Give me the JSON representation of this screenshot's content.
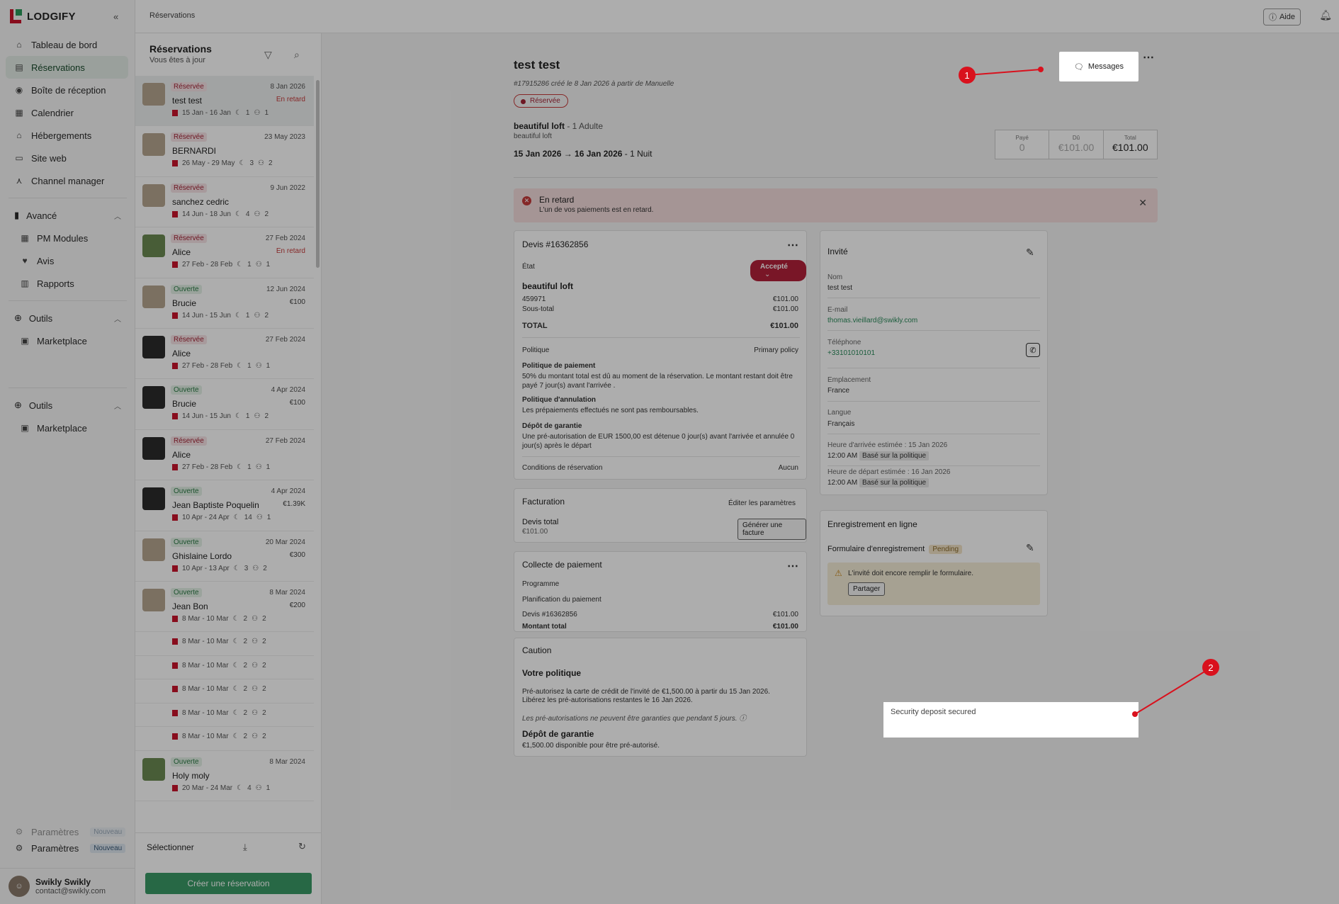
{
  "app": {
    "brand": "LODGIFY",
    "collapse_icon": "double-chevron-left-icon"
  },
  "nav": {
    "items": [
      {
        "label": "Tableau de bord",
        "icon": "home-icon"
      },
      {
        "label": "Réservations",
        "icon": "book-icon",
        "active": true
      },
      {
        "label": "Boîte de réception",
        "icon": "chat-icon"
      },
      {
        "label": "Calendrier",
        "icon": "calendar-icon"
      },
      {
        "label": "Hébergements",
        "icon": "house-icon"
      },
      {
        "label": "Site web",
        "icon": "browser-icon"
      },
      {
        "label": "Channel manager",
        "icon": "network-icon"
      }
    ],
    "advanced": {
      "label": "Avancé",
      "items": [
        "PM Modules",
        "Avis",
        "Rapports"
      ]
    },
    "tools1": {
      "label": "Outils",
      "items": [
        "Marketplace"
      ]
    },
    "tools2": {
      "label": "Outils",
      "items": [
        "Marketplace"
      ]
    },
    "settings_ghost": "Paramètres",
    "settings": "Paramètres",
    "new_badge": "Nouveau"
  },
  "user": {
    "name": "Swikly Swikly",
    "email": "contact@swikly.com"
  },
  "topbar": {
    "breadcrumb": "Réservations",
    "help": "Aide"
  },
  "list": {
    "title": "Réservations",
    "subtitle": "Vous êtes à jour",
    "rows": [
      {
        "status": "Réservée",
        "type": "res",
        "date": "8 Jan 2026",
        "name": "test test",
        "note": "En retard",
        "range": "15 Jan - 16 Jan",
        "nights": "1",
        "guests": "1",
        "thumb": "photo"
      },
      {
        "status": "Réservée",
        "type": "res",
        "date": "23 May 2023",
        "name": "BERNARDI",
        "note": "",
        "range": "26 May - 29 May",
        "nights": "3",
        "guests": "2",
        "thumb": "photo"
      },
      {
        "status": "Réservée",
        "type": "res",
        "date": "9 Jun 2022",
        "name": "sanchez cedric",
        "note": "",
        "range": "14 Jun - 18 Jun",
        "nights": "4",
        "guests": "2",
        "thumb": "photo"
      },
      {
        "status": "Réservée",
        "type": "res",
        "date": "27 Feb 2024",
        "name": "Alice",
        "note": "En retard",
        "range": "27 Feb - 28 Feb",
        "nights": "1",
        "guests": "1",
        "thumb": "green"
      },
      {
        "status": "Ouverte",
        "type": "open",
        "date": "12 Jun 2024",
        "name": "Brucie",
        "note": "€100",
        "range": "14 Jun - 15 Jun",
        "nights": "1",
        "guests": "2",
        "thumb": "photo"
      },
      {
        "status": "Réservée",
        "type": "res",
        "date": "27 Feb 2024",
        "name": "Alice",
        "note": "",
        "range": "27 Feb - 28 Feb",
        "nights": "1",
        "guests": "1",
        "thumb": "dark"
      },
      {
        "status": "Ouverte",
        "type": "open",
        "date": "4 Apr 2024",
        "name": "Brucie",
        "note": "€100",
        "range": "14 Jun - 15 Jun",
        "nights": "1",
        "guests": "2",
        "thumb": "dark"
      },
      {
        "status": "Réservée",
        "type": "res",
        "date": "27 Feb 2024",
        "name": "Alice",
        "note": "",
        "range": "27 Feb - 28 Feb",
        "nights": "1",
        "guests": "1",
        "thumb": "dark"
      },
      {
        "status": "Ouverte",
        "type": "open",
        "date": "4 Apr 2024",
        "name": "Jean Baptiste Poquelin",
        "note": "€1.39K",
        "range": "10 Apr - 24 Apr",
        "nights": "14",
        "guests": "1",
        "thumb": "dark"
      },
      {
        "status": "Ouverte",
        "type": "open",
        "date": "20 Mar 2024",
        "name": "Ghislaine Lordo",
        "note": "€300",
        "range": "10 Apr - 13 Apr",
        "nights": "3",
        "guests": "2",
        "thumb": "photo"
      },
      {
        "status": "Ouverte",
        "type": "open",
        "date": "8 Mar 2024",
        "name": "Jean Bon",
        "note": "€200",
        "range": "8 Mar - 10 Mar",
        "nights": "2",
        "guests": "2",
        "thumb": "photo"
      }
    ],
    "ghost_rows": [
      {
        "range": "8 Mar - 10 Mar",
        "nights": "2",
        "guests": "2"
      },
      {
        "range": "8 Mar - 10 Mar",
        "nights": "2",
        "guests": "2"
      },
      {
        "range": "8 Mar - 10 Mar",
        "nights": "2",
        "guests": "2"
      },
      {
        "range": "8 Mar - 10 Mar",
        "nights": "2",
        "guests": "2"
      },
      {
        "range": "8 Mar - 10 Mar",
        "nights": "2",
        "guests": "2"
      }
    ],
    "last_row": {
      "status": "Ouverte",
      "date": "8 Mar 2024",
      "name": "Holy moly",
      "range": "20 Mar - 24 Mar",
      "nights": "4",
      "guests": "1"
    },
    "select_ghost": "Sélectionner",
    "select": "Sélectionner",
    "create": "Créer une réservation"
  },
  "header": {
    "title": "test test",
    "subtitle": "#17915286 créé le 8 Jan 2026 à partir de Manuelle",
    "badge": "Réservée",
    "property": "beautiful loft",
    "guests": " - 1 Adulte",
    "property_sub": "beautiful loft",
    "dates": "15 Jan 2026 → 16 Jan 2026",
    "nights": " - 1 Nuit",
    "messages": "Messages",
    "totals": [
      {
        "label": "Payé",
        "value": "0"
      },
      {
        "label": "Dû",
        "value": "€101.00"
      },
      {
        "label": "Total",
        "value": "€101.00"
      }
    ]
  },
  "alert": {
    "title": "En retard",
    "text": "L'un de vos paiements est en retard."
  },
  "quote": {
    "title": "Devis #16362856",
    "state_label": "État",
    "state": "Accepté",
    "property": "beautiful loft",
    "line_id": "459971",
    "line_amount": "€101.00",
    "subtotal_label": "Sous-total",
    "subtotal": "€101.00",
    "total_label": "TOTAL",
    "total": "€101.00",
    "policy_label": "Politique",
    "policy": "Primary policy",
    "payment_title": "Politique de paiement",
    "payment_text": "50% du montant total est dû au moment de la réservation. Le montant restant doit être payé 7 jour(s) avant l'arrivée .",
    "cancel_title": "Politique d'annulation",
    "cancel_text": "Les prépaiements effectués ne sont pas remboursables.",
    "deposit_title": "Dépôt de garantie",
    "deposit_text": "Une pré-autorisation de EUR 1500,00 est détenue 0 jour(s) avant l'arrivée et annulée 0 jour(s) après le départ",
    "conditions_label": "Conditions de réservation",
    "conditions": "Aucun"
  },
  "billing": {
    "title": "Facturation",
    "edit": "Éditer les paramètres",
    "label": "Devis total",
    "amount": "€101.00",
    "button": "Générer une facture"
  },
  "collect": {
    "title": "Collecte de paiement",
    "program": "Programme",
    "planning": "Planification du paiement",
    "quote": "Devis #16362856",
    "quote_amount": "€101.00",
    "total_label": "Montant total",
    "total": "€101.00"
  },
  "caution": {
    "title": "Caution",
    "policy_title": "Votre politique",
    "line1": "Pré-autorisez la carte de crédit de l'invité de €1,500.00 à partir du 15 Jan 2026.",
    "line2": "Libérez les pré-autorisations restantes le 16 Jan 2026.",
    "note": "Les pré-autorisations ne peuvent être garanties que pendant 5 jours.",
    "deposit_title": "Dépôt de garantie",
    "deposit_text": "€1,500.00 disponible pour être pré-autorisé."
  },
  "guest": {
    "title": "Invité",
    "name_label": "Nom",
    "name": "test test",
    "email_label": "E-mail",
    "email": "thomas.vieillard@swikly.com",
    "phone_label": "Téléphone",
    "phone": "+33101010101",
    "location_label": "Emplacement",
    "location": "France",
    "lang_label": "Langue",
    "lang": "Français",
    "arrival_label": "Heure d'arrivée estimée : 15 Jan 2026",
    "arrival": "12:00 AM",
    "arrival_tag": "Basé sur la politique",
    "departure_label": "Heure de départ estimée : 16 Jan 2026",
    "departure": "12:00 AM",
    "departure_tag": "Basé sur la politique"
  },
  "checkin": {
    "title": "Enregistrement en ligne",
    "form": "Formulaire d'enregistrement",
    "status": "Pending",
    "warning": "L'invité doit encore remplir le formulaire.",
    "share": "Partager"
  },
  "deposit_popup": "Security deposit secured",
  "markers": [
    "1",
    "2"
  ],
  "colors": {
    "brand": "#c9142b",
    "accent_green": "#3a9a66",
    "accepted": "#b3213a",
    "marker": "#d9111d"
  }
}
